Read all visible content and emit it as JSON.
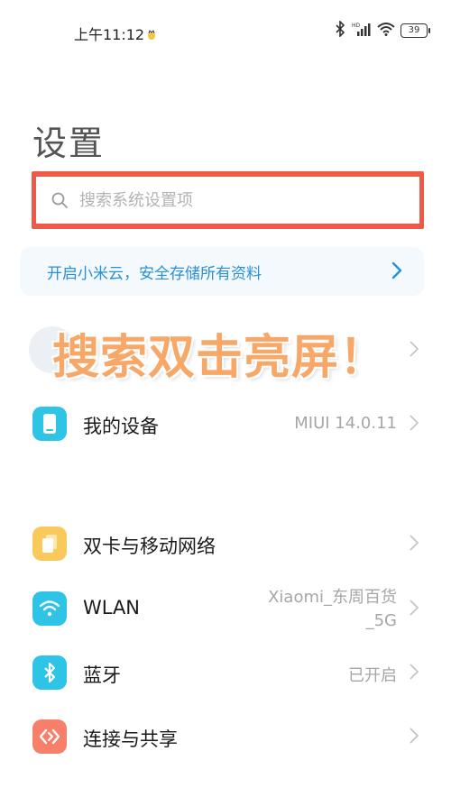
{
  "status_bar": {
    "time": "上午11:12",
    "battery": "39"
  },
  "page": {
    "title": "设置"
  },
  "search": {
    "placeholder": "搜索系统设置项"
  },
  "cloud_banner": {
    "text": "开启小米云，安全存储所有资料"
  },
  "overlay": {
    "promo_text": "搜索双击亮屏！"
  },
  "settings": {
    "my_device": {
      "label": "我的设备",
      "value": "MIUI 14.0.11"
    },
    "dual_sim": {
      "label": "双卡与移动网络"
    },
    "wlan": {
      "label": "WLAN",
      "value_line1": "Xiaomi_东周百货",
      "value_line2": "_5G"
    },
    "bluetooth": {
      "label": "蓝牙",
      "value": "已开启"
    },
    "connection": {
      "label": "连接与共享"
    }
  },
  "colors": {
    "search_highlight": "#ee5a48",
    "cloud_text": "#2a8fd8",
    "device_icon": "#2ec4e6",
    "sim_icon": "#f9c95c",
    "wlan_icon": "#2ec4e6",
    "bluetooth_icon": "#2ec4e6",
    "connection_icon": "#f7806b"
  }
}
